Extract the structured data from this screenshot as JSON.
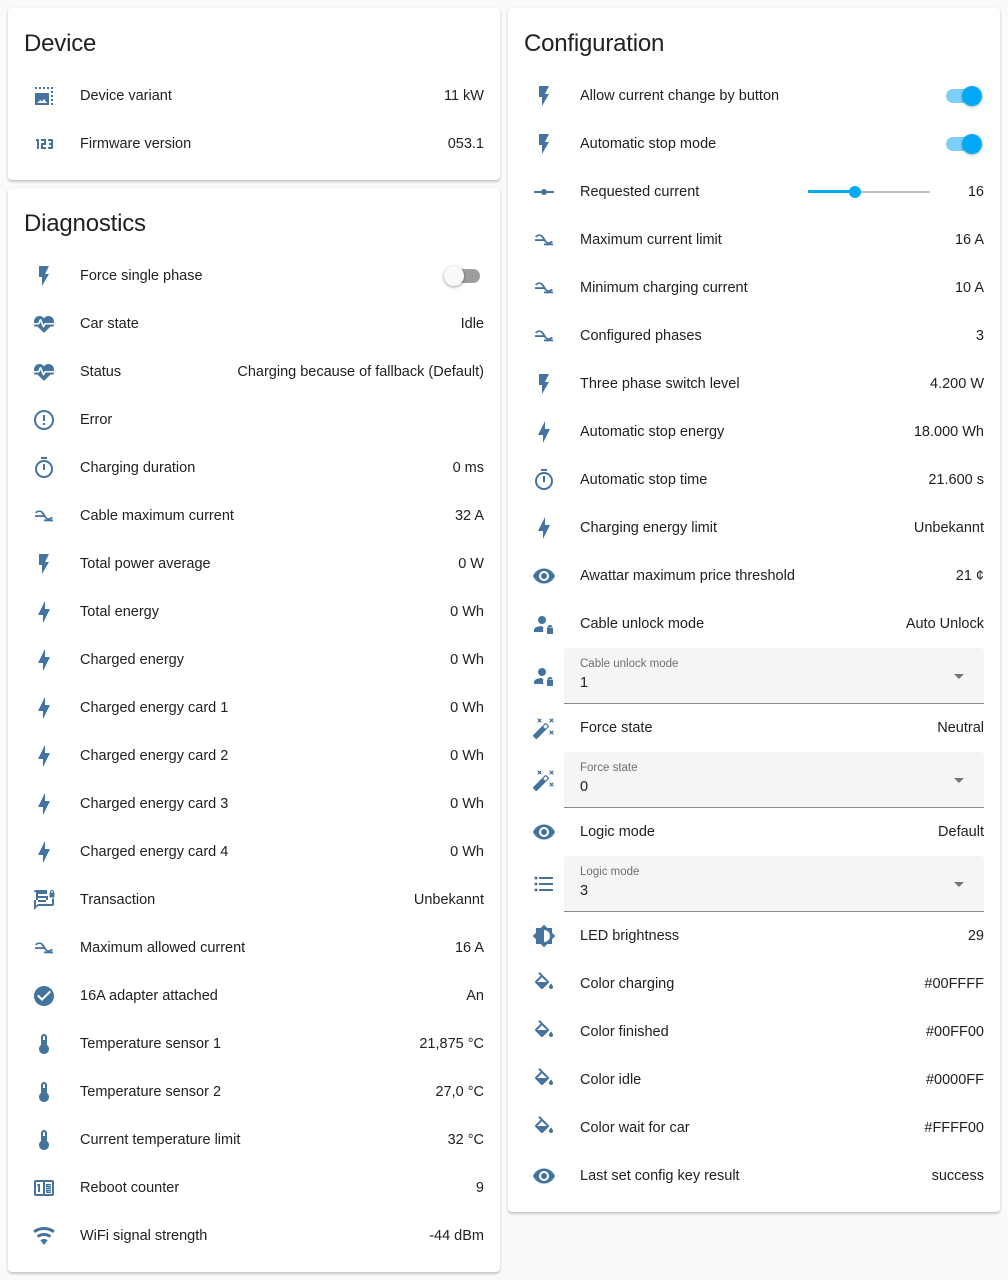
{
  "device": {
    "title": "Device",
    "rows": [
      {
        "label": "Device variant",
        "value": "11 kW",
        "icon": "image-filter-center-focus-icon"
      },
      {
        "label": "Firmware version",
        "value": "053.1",
        "icon": "numeric-icon"
      }
    ]
  },
  "diagnostics": {
    "title": "Diagnostics",
    "force_single_phase": {
      "label": "Force single phase",
      "state": "off"
    },
    "rows": [
      {
        "label": "Car state",
        "value": "Idle"
      },
      {
        "label": "Status",
        "value": "Charging because of fallback (Default)"
      },
      {
        "label": "Error",
        "value": ""
      },
      {
        "label": "Charging duration",
        "value": "0 ms"
      },
      {
        "label": "Cable maximum current",
        "value": "32 A"
      },
      {
        "label": "Total power average",
        "value": "0 W"
      },
      {
        "label": "Total energy",
        "value": "0 Wh"
      },
      {
        "label": "Charged energy",
        "value": "0 Wh"
      },
      {
        "label": "Charged energy card 1",
        "value": "0 Wh"
      },
      {
        "label": "Charged energy card 2",
        "value": "0 Wh"
      },
      {
        "label": "Charged energy card 3",
        "value": "0 Wh"
      },
      {
        "label": "Charged energy card 4",
        "value": "0 Wh"
      },
      {
        "label": "Transaction",
        "value": "Unbekannt"
      },
      {
        "label": "Maximum allowed current",
        "value": "16 A"
      },
      {
        "label": "16A adapter attached",
        "value": "An"
      },
      {
        "label": "Temperature sensor 1",
        "value": "21,875 °C"
      },
      {
        "label": "Temperature sensor 2",
        "value": "27,0 °C"
      },
      {
        "label": "Current temperature limit",
        "value": "32 °C"
      },
      {
        "label": "Reboot counter",
        "value": "9"
      },
      {
        "label": "WiFi signal strength",
        "value": "-44 dBm"
      }
    ]
  },
  "configuration": {
    "title": "Configuration",
    "allow_current_change": {
      "label": "Allow current change by button",
      "state": "on"
    },
    "automatic_stop_mode": {
      "label": "Automatic stop mode",
      "state": "on"
    },
    "requested_current": {
      "label": "Requested current",
      "value": "16",
      "slider_fraction": 0.385
    },
    "rows_a": [
      {
        "label": "Maximum current limit",
        "value": "16 A"
      },
      {
        "label": "Minimum charging current",
        "value": "10 A"
      },
      {
        "label": "Configured phases",
        "value": "3"
      },
      {
        "label": "Three phase switch level",
        "value": "4.200 W"
      },
      {
        "label": "Automatic stop energy",
        "value": "18.000 Wh"
      },
      {
        "label": "Automatic stop time",
        "value": "21.600 s"
      },
      {
        "label": "Charging energy limit",
        "value": "Unbekannt"
      },
      {
        "label": "Awattar maximum price threshold",
        "value": "21 ¢"
      },
      {
        "label": "Cable unlock mode",
        "value": "Auto Unlock"
      }
    ],
    "cable_unlock_select": {
      "label": "Cable unlock mode",
      "value": "1"
    },
    "force_state": {
      "label": "Force state",
      "value": "Neutral"
    },
    "force_state_select": {
      "label": "Force state",
      "value": "0"
    },
    "logic_mode": {
      "label": "Logic mode",
      "value": "Default"
    },
    "logic_mode_select": {
      "label": "Logic mode",
      "value": "3"
    },
    "rows_b": [
      {
        "label": "LED brightness",
        "value": "29"
      },
      {
        "label": "Color charging",
        "value": "#00FFFF"
      },
      {
        "label": "Color finished",
        "value": "#00FF00"
      },
      {
        "label": "Color idle",
        "value": "#0000FF"
      },
      {
        "label": "Color wait for car",
        "value": "#FFFF00"
      },
      {
        "label": "Last set config key result",
        "value": "success"
      }
    ]
  },
  "colors": {
    "icon": "#44739e",
    "accent": "#03a9f4",
    "accent_light": "#7ccff9",
    "toggle_off_track": "#9e9e9e"
  }
}
